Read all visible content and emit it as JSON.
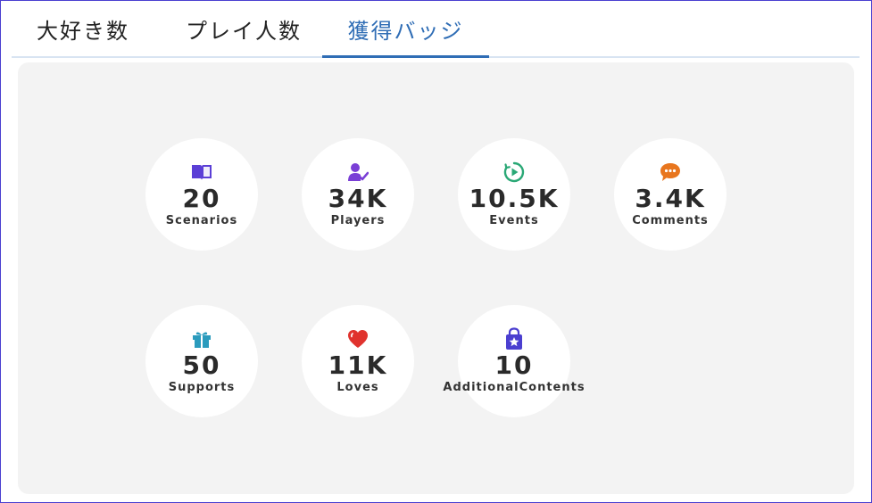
{
  "tabs": [
    {
      "label": "大好き数",
      "active": false
    },
    {
      "label": "プレイ人数",
      "active": false
    },
    {
      "label": "獲得バッジ",
      "active": true
    }
  ],
  "colors": {
    "frame_border": "#4a3fd0",
    "active_tab": "#2f6db5",
    "panel_bg": "#f3f3f3"
  },
  "badges": [
    {
      "value": "20",
      "label": "Scenarios",
      "icon": "book-icon",
      "color": "#5b3fd6"
    },
    {
      "value": "34K",
      "label": "Players",
      "icon": "user-check-icon",
      "color": "#7a3fd6"
    },
    {
      "value": "10.5K",
      "label": "Events",
      "icon": "play-clock-icon",
      "color": "#2aa876"
    },
    {
      "value": "3.4K",
      "label": "Comments",
      "icon": "chat-bubble-icon",
      "color": "#e8761e"
    },
    {
      "value": "50",
      "label": "Supports",
      "icon": "gift-icon",
      "color": "#2b9bbd"
    },
    {
      "value": "11K",
      "label": "Loves",
      "icon": "heart-icon",
      "color": "#e0332e"
    },
    {
      "value": "10",
      "label": "AdditionalContents",
      "icon": "shopping-bag-star-icon",
      "color": "#4b3fd0"
    }
  ]
}
